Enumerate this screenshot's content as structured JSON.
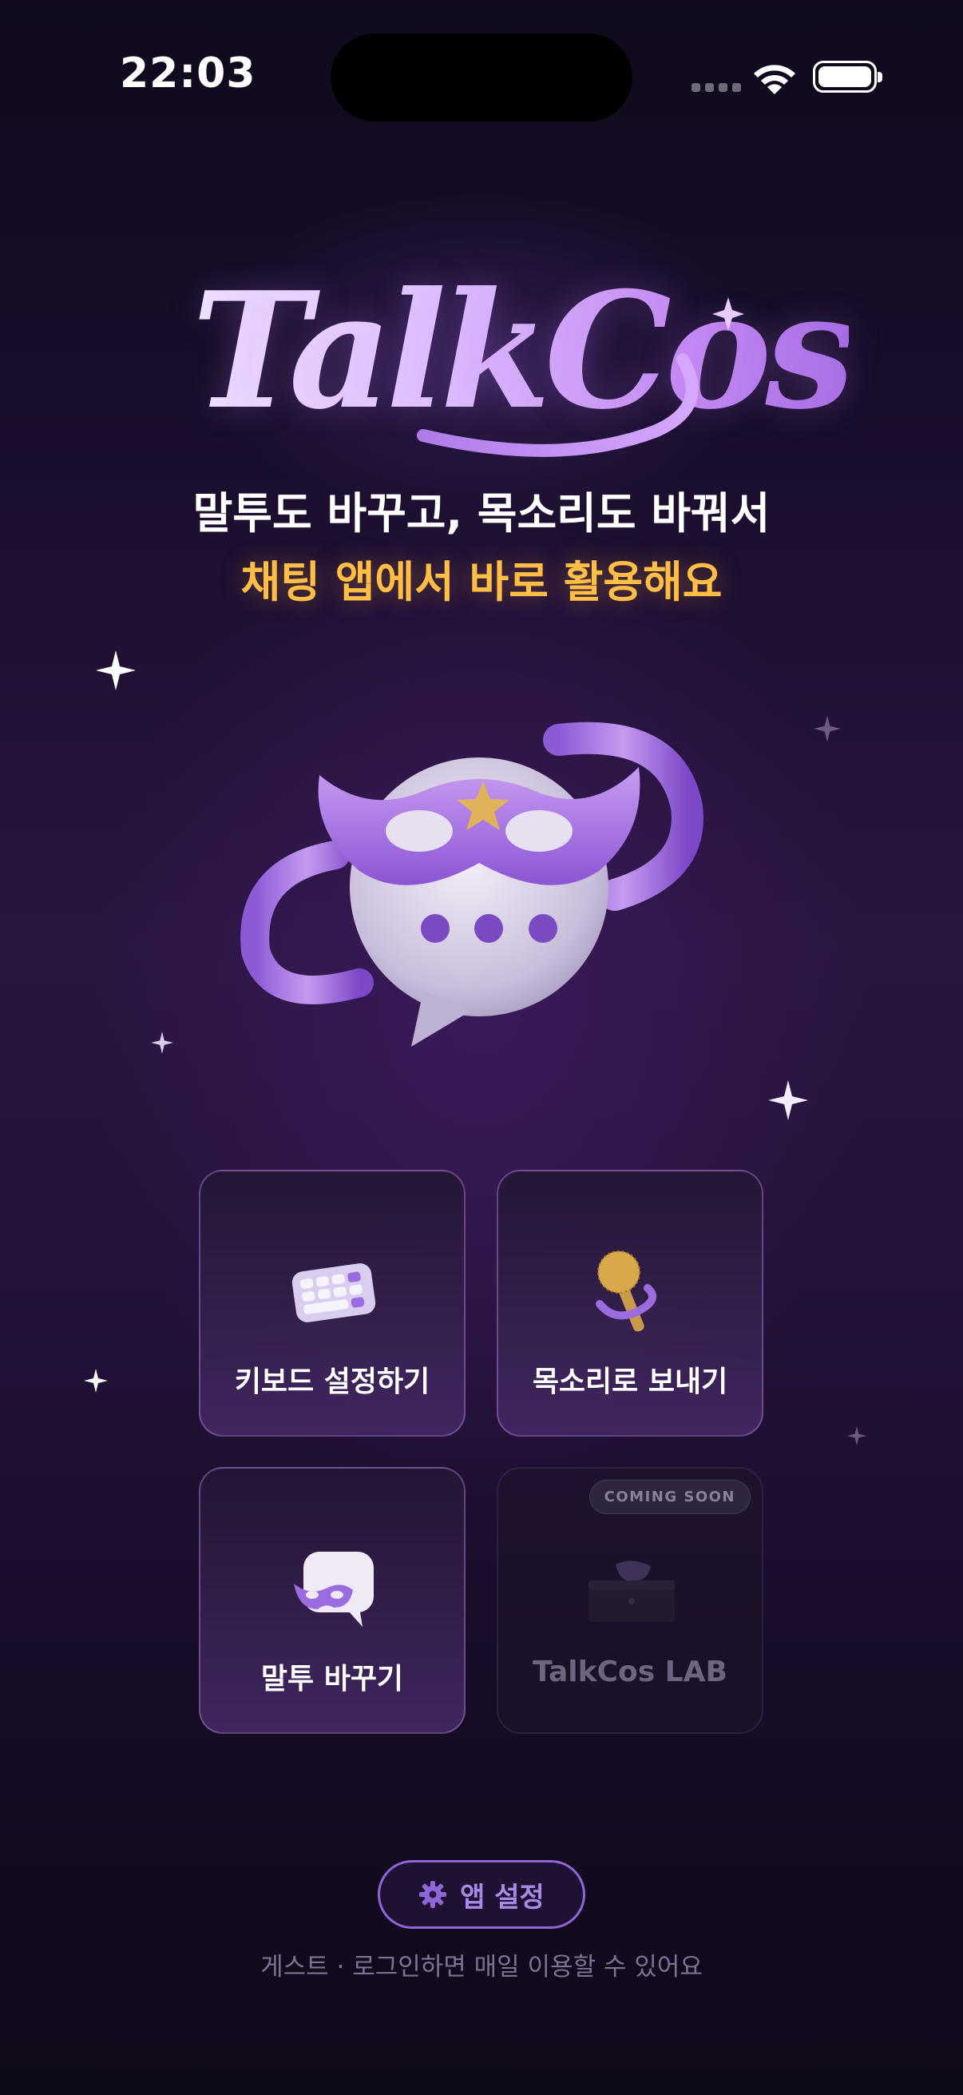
{
  "status_bar": {
    "time": "22:03"
  },
  "header": {
    "logo_text": "TalkCos",
    "tagline_primary": "말투도 바꾸고, 목소리도 바꿔서",
    "tagline_accent": "채팅 앱에서 바로 활용해요"
  },
  "menu": {
    "keyboard_settings": "키보드 설정하기",
    "send_voice": "목소리로 보내기",
    "change_tone": "말투 바꾸기",
    "lab": "TalkCos LAB",
    "lab_badge": "COMING SOON"
  },
  "footer": {
    "settings_label": "앱 설정",
    "guest_notice": "게스트 · 로그인하면 매일 이용할 수 있어요"
  },
  "colors": {
    "accent_yellow": "#ffbe45",
    "accent_purple": "#8e66d8",
    "background": "#1c0f2f"
  },
  "icons": [
    "wifi-icon",
    "battery-icon",
    "keyboard-icon",
    "microphone-icon",
    "mask-chat-icon",
    "treasure-box-icon",
    "gear-icon",
    "sparkle-icon"
  ]
}
